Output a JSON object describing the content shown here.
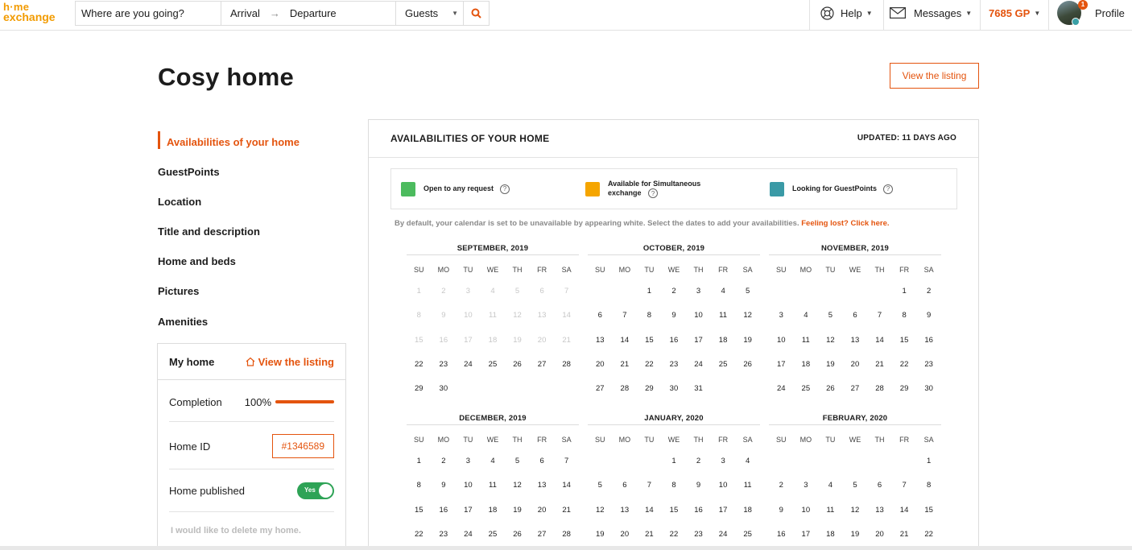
{
  "topnav": {
    "logo_line1": "h·me",
    "logo_line2": "exchange",
    "search_placeholder": "Where are you going?",
    "arrival": "Arrival",
    "departure": "Departure",
    "guests": "Guests",
    "help": "Help",
    "messages": "Messages",
    "guestpoints": "7685 GP",
    "notifications": "1",
    "profile": "Profile"
  },
  "page": {
    "title": "Cosy home",
    "view_listing": "View the listing"
  },
  "sidebar": {
    "items": [
      {
        "label": "Availabilities of your home",
        "active": true
      },
      {
        "label": "GuestPoints",
        "active": false
      },
      {
        "label": "Location",
        "active": false
      },
      {
        "label": "Title and description",
        "active": false
      },
      {
        "label": "Home and beds",
        "active": false
      },
      {
        "label": "Pictures",
        "active": false
      },
      {
        "label": "Amenities",
        "active": false
      }
    ]
  },
  "card": {
    "title": "My home",
    "view_listing": "View the listing",
    "completion_label": "Completion",
    "completion_value": "100%",
    "completion_fraction": 1.0,
    "home_id_label": "Home ID",
    "home_id": "#1346589",
    "published_label": "Home published",
    "published_toggle": "Yes",
    "delete": "I would like to delete my home."
  },
  "panel": {
    "title": "AVAILABILITIES OF YOUR HOME",
    "updated": "UPDATED: 11 DAYS AGO",
    "legend": [
      {
        "label": "Open to any request",
        "color": "#4cbb5e"
      },
      {
        "label": "Available for Simultaneous exchange",
        "color": "#f5a500"
      },
      {
        "label": "Looking for GuestPoints",
        "color": "#3a9aa6"
      }
    ],
    "note": "By default, your calendar is set to be unavailable by appearing white. Select the dates to add your availabilities.",
    "note_link": "Feeling lost? Click here.",
    "weekdays": [
      "SU",
      "MO",
      "TU",
      "WE",
      "TH",
      "FR",
      "SA"
    ],
    "months": [
      {
        "name": "SEPTEMBER, 2019",
        "offset": 0,
        "days": 30,
        "past_until": 21
      },
      {
        "name": "OCTOBER, 2019",
        "offset": 2,
        "days": 31,
        "past_until": 0
      },
      {
        "name": "NOVEMBER, 2019",
        "offset": 5,
        "days": 30,
        "past_until": 0
      },
      {
        "name": "DECEMBER, 2019",
        "offset": 0,
        "days": 31,
        "past_until": 0
      },
      {
        "name": "JANUARY, 2020",
        "offset": 3,
        "days": 31,
        "past_until": 0
      },
      {
        "name": "FEBRUARY, 2020",
        "offset": 6,
        "days": 29,
        "past_until": 0
      }
    ]
  },
  "colors": {
    "accent": "#e4540e",
    "logo": "#f29b00",
    "toggle_on": "#2ea356"
  }
}
